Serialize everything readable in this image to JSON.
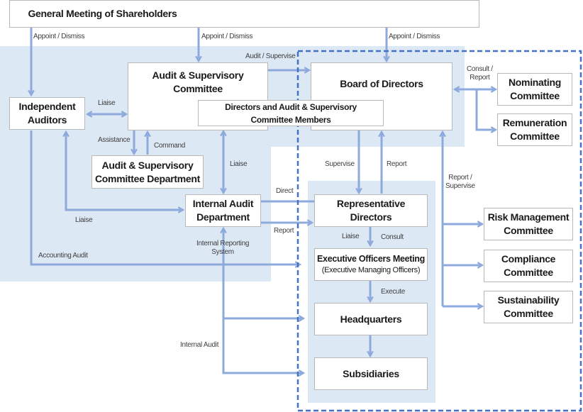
{
  "colors": {
    "region_fill": "#dde8f5",
    "connector": "#8eaadc",
    "dashed_border": "#4472c4",
    "box_border": "#b8b8b8",
    "text": "#1a1a1a",
    "label_text": "#404040"
  },
  "nodes": {
    "shareholders": {
      "line1": "General Meeting of Shareholders"
    },
    "independent_auditors": {
      "line1": "Independent",
      "line2": "Auditors"
    },
    "audit_committee": {
      "line1": "Audit & Supervisory",
      "line2": "Committee"
    },
    "directors_members": {
      "line1": "Directors and Audit & Supervisory",
      "line2": "Committee Members"
    },
    "board": {
      "line1": "Board of Directors"
    },
    "nominating": {
      "line1": "Nominating",
      "line2": "Committee"
    },
    "remuneration": {
      "line1": "Remuneration",
      "line2": "Committee"
    },
    "audit_dept": {
      "line1": "Audit & Supervisory",
      "line2": "Committee Department"
    },
    "internal_audit": {
      "line1": "Internal Audit",
      "line2": "Department"
    },
    "rep_directors": {
      "line1": "Representative",
      "line2": "Directors"
    },
    "exec_meeting": {
      "line1": "Executive Officers Meeting",
      "line2": "(Executive Managing  Officers)"
    },
    "headquarters": {
      "line1": "Headquarters"
    },
    "subsidiaries": {
      "line1": "Subsidiaries"
    },
    "risk": {
      "line1": "Risk Management",
      "line2": "Committee"
    },
    "compliance": {
      "line1": "Compliance",
      "line2": "Committee"
    },
    "sustainability": {
      "line1": "Sustainability",
      "line2": "Committee"
    }
  },
  "labels": {
    "appoint1": "Appoint / Dismiss",
    "appoint2": "Appoint / Dismiss",
    "appoint3": "Appoint / Dismiss",
    "audit_supervise": "Audit / Supervise",
    "consult_report1": "Consult /",
    "consult_report2": "Report",
    "liaise_ia_ac": "Liaise",
    "assistance": "Assistance",
    "command": "Command",
    "liaise_ac_iad": "Liaise",
    "supervise": "Supervise",
    "report_rd": "Report",
    "report_supervise1": "Report /",
    "report_supervise2": "Supervise",
    "direct": "Direct",
    "report_iad": "Report",
    "liaise_bottom": "Liaise",
    "liaise_rd": "Liaise",
    "consult_rd": "Consult",
    "internal_reporting1": "Internal Reporting",
    "internal_reporting2": "System",
    "accounting_audit": "Accounting Audit",
    "execute": "Execute",
    "internal_audit": "Internal Audit"
  }
}
